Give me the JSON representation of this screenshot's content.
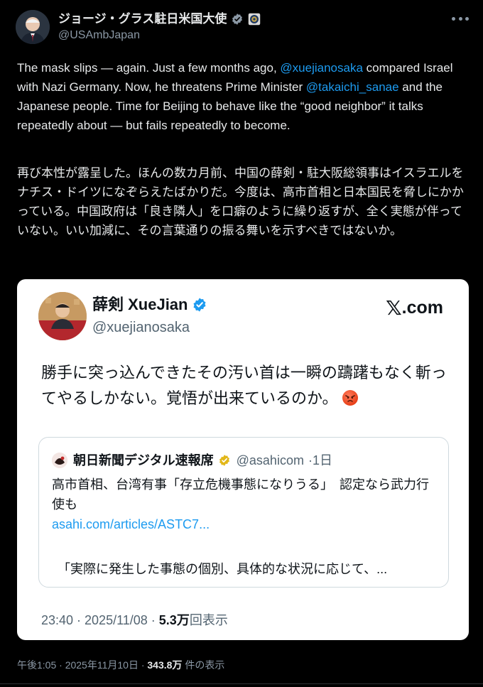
{
  "post": {
    "author_name": "ジョージ・グラス駐日米国大使",
    "author_handle": "@USAmbJapan",
    "verified_icon": "verified-badge-icon",
    "affiliation_icon": "us-seal-icon",
    "more_icon": "more-options-icon",
    "text_en_parts": {
      "p1": "The mask slips — again. Just a few months ago,",
      "mention1": "@xuejianosaka",
      "p2": "compared Israel with Nazi Germany. Now, he threatens Prime Minister",
      "mention2": "@takaichi_sanae",
      "p3": "and the Japanese people. Time for Beijing to behave like the “good neighbor” it talks repeatedly about — but fails repeatedly to become."
    },
    "text_ja": "再び本性が露呈した。ほんの数カ月前、中国の薛剣・駐大阪総領事はイスラエルをナチス・ドイツになぞらえたばかりだ。今度は、高市首相と日本国民を脅しにかかっている。中国政府は「良き隣人」を口癖のように繰り返すが、全く実態が伴っていない。いい加減に、その言葉通りの振る舞いを示すべきではないか。",
    "meta": {
      "time": "午後1:05 · 2025年11月10日 · ",
      "views_count": "343.8万",
      "views_label": " 件の表示"
    }
  },
  "embedded_screenshot": {
    "author_name": "薛剣 XueJian",
    "author_handle": "@xuejianosaka",
    "site_label": ".com",
    "site_mark": "𝕏",
    "text": "勝手に突っ込んできたその汚い首は一瞬の躊躇もなく斬ってやるしかない。覚悟が出来ているのか。",
    "emoji_icon": "angry-face-emoji",
    "quote": {
      "author_name": "朝日新聞デジタル速報席",
      "author_handle": "@asahicom",
      "age": "·1日",
      "text": "高市首相、台湾有事「存立危機事態になりうる」　認定なら武力行使も",
      "link": "asahi.com/articles/ASTC7...",
      "extra": "「実際に発生した事態の個別、具体的な状況に応じて、..."
    },
    "meta": {
      "time": "23:40 · 2025/11/08 · ",
      "views_count": "5.3万",
      "views_label": "回表示"
    }
  },
  "colors": {
    "background": "#000000",
    "text": "#e7e9ea",
    "secondary": "#8b98a5",
    "link": "#1d9bf0",
    "verified_blue": "#1d9bf0",
    "verified_gold": "#e2b719"
  }
}
